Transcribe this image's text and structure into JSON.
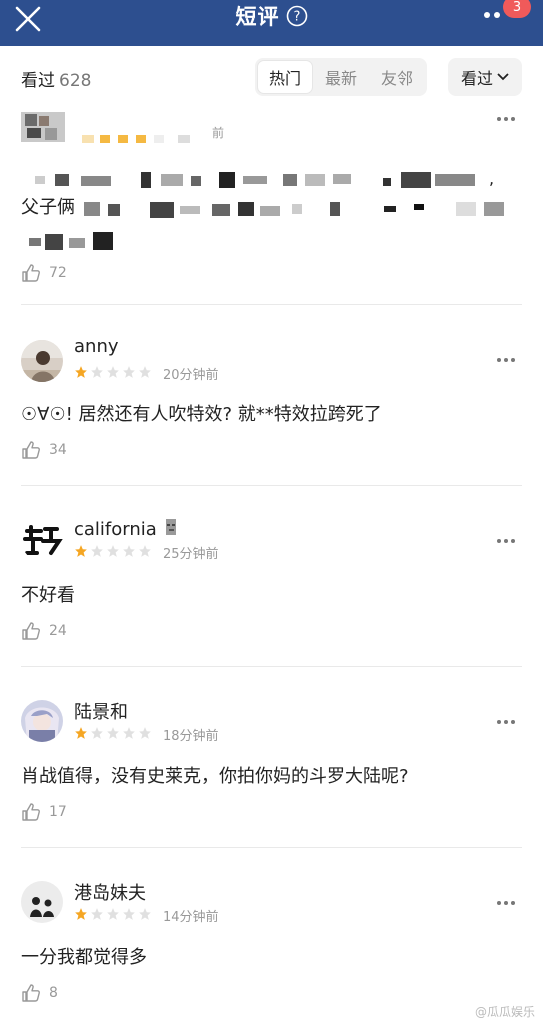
{
  "header": {
    "title": "短评",
    "notification_count": "3"
  },
  "subbar": {
    "count_label": "看过",
    "count_value": "628",
    "tabs": [
      "热门",
      "最新",
      "友邻"
    ],
    "filter_label": "看过"
  },
  "first_comment": {
    "time": "前",
    "content_prefix": "父子俩",
    "likes": "72"
  },
  "comments": [
    {
      "username": "anny",
      "rating": 1,
      "time": "20分钟前",
      "content": "☉∀☉! 居然还有人吹特效? 就**特效拉跨死了",
      "likes": "34"
    },
    {
      "username": "california",
      "rating": 1,
      "time": "25分钟前",
      "content": "不好看",
      "likes": "24"
    },
    {
      "username": "陆景和",
      "rating": 1,
      "time": "18分钟前",
      "content": "肖战值得，没有史莱克，你拍你妈的斗罗大陆呢?",
      "likes": "17"
    },
    {
      "username": "港岛妹夫",
      "rating": 1,
      "time": "14分钟前",
      "content": "一分我都觉得多",
      "likes": "8"
    }
  ],
  "watermark": "@瓜瓜娱乐",
  "colors": {
    "header_bg": "#2d4f8f",
    "star_filled": "#f5a623",
    "star_empty": "#e0e0e0",
    "badge": "#f05a5a"
  }
}
